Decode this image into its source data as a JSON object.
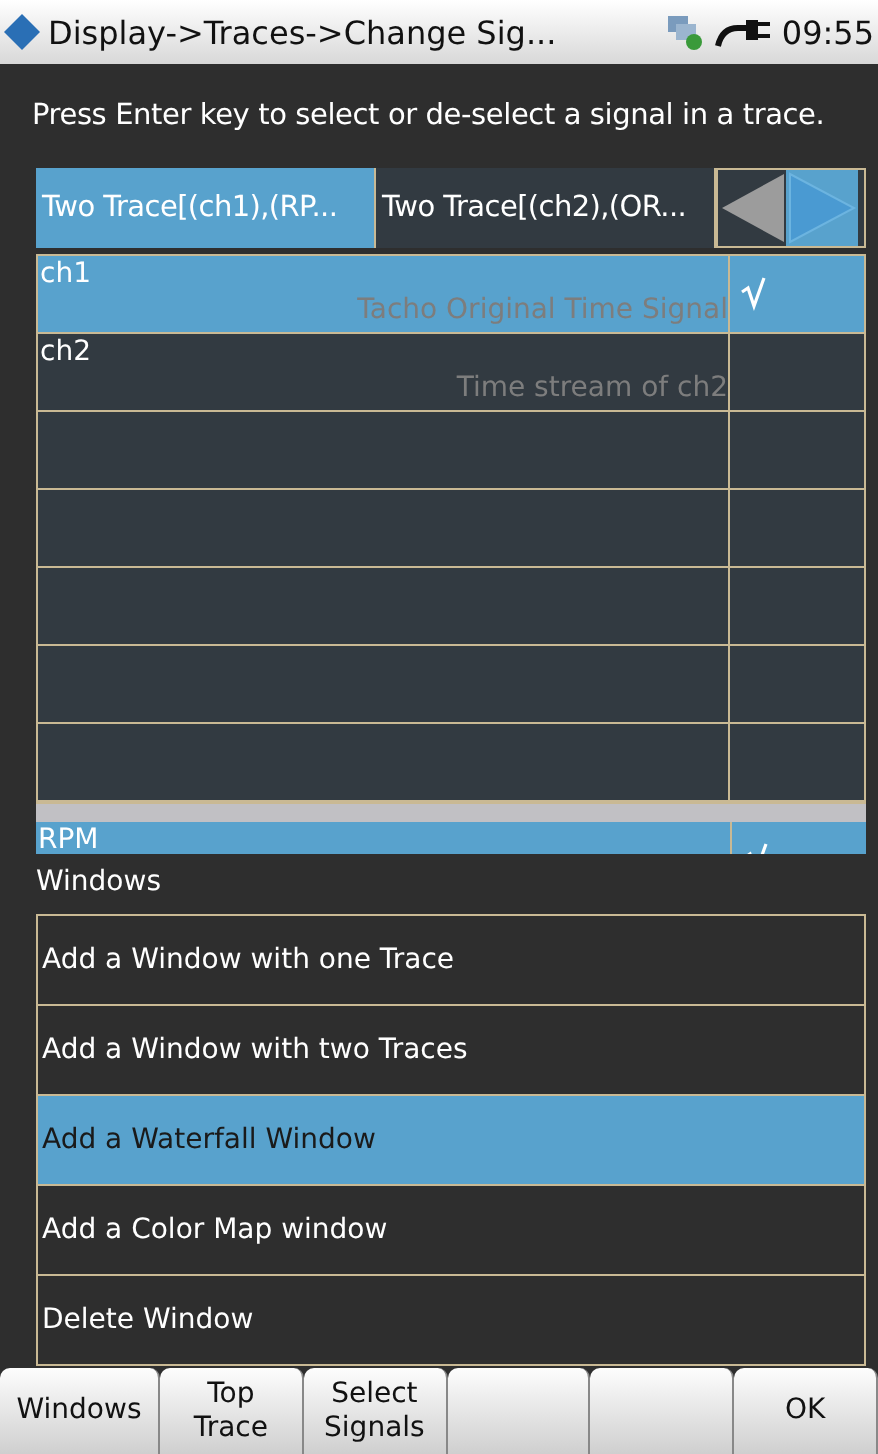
{
  "status_bar": {
    "title": "Display->Traces->Change Sig...",
    "time": "09:55"
  },
  "instruction": "Press Enter key to select or de-select a signal in a trace.",
  "tabs": [
    {
      "label": "Two Trace[(ch1),(RP...",
      "selected": true
    },
    {
      "label": "Two Trace[(ch2),(OR...",
      "selected": false
    }
  ],
  "signals": [
    {
      "name": "ch1",
      "description": "Tacho Original Time Signal",
      "checked": true,
      "selected": true
    },
    {
      "name": "ch2",
      "description": "Time stream of ch2",
      "checked": false,
      "selected": false
    }
  ],
  "second_list": [
    {
      "name": "RPM",
      "checked": true,
      "selected": true
    }
  ],
  "windows_menu": {
    "title": "Windows",
    "items": [
      {
        "label": "Add a Window with one Trace",
        "selected": false
      },
      {
        "label": "Add a Window with two Traces",
        "selected": false
      },
      {
        "label": "Add a Waterfall Window",
        "selected": true
      },
      {
        "label": "Add a Color Map window",
        "selected": false
      },
      {
        "label": "Delete Window",
        "selected": false
      }
    ]
  },
  "softkeys_left": [
    {
      "label": "Windows"
    },
    {
      "label": "Top\nTrace"
    },
    {
      "label": "Select\nSignals"
    }
  ],
  "softkeys_right": [
    {
      "label": "OK"
    }
  ]
}
